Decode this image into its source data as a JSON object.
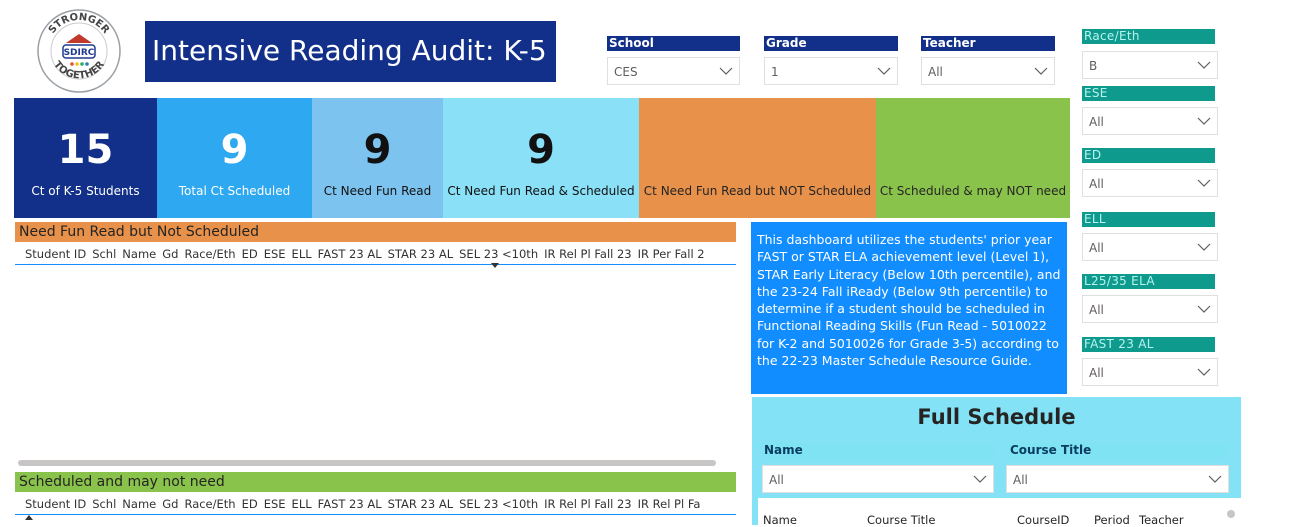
{
  "logo": {
    "top_text": "STRONGER",
    "middle_text": "SDIRC",
    "bottom_text": "TOGETHER"
  },
  "title": "Intensive Reading Audit: K-5",
  "slicers": {
    "school": {
      "label": "School",
      "value": "CES"
    },
    "grade": {
      "label": "Grade",
      "value": "1"
    },
    "teacher": {
      "label": "Teacher",
      "value": "All"
    },
    "race_eth": {
      "label": "Race/Eth",
      "value": "B"
    },
    "ese": {
      "label": "ESE",
      "value": "All"
    },
    "ed": {
      "label": "ED",
      "value": "All"
    },
    "ell": {
      "label": "ELL",
      "value": "All"
    },
    "l25": {
      "label": "L25/35 ELA",
      "value": "All"
    },
    "fast23": {
      "label": "FAST 23 AL",
      "value": "All"
    }
  },
  "cards": [
    {
      "value": "15",
      "label": "Ct of K-5 Students",
      "bg": "#12308a",
      "fg": "#ffffff"
    },
    {
      "value": "9",
      "label": "Total Ct Scheduled",
      "bg": "#2ea8f0",
      "fg": "#ffffff"
    },
    {
      "value": "9",
      "label": "Ct Need Fun Read",
      "bg": "#7cc3f0",
      "fg": "#111111"
    },
    {
      "value": "9",
      "label": "Ct Need Fun Read & Scheduled",
      "bg": "#8ae0f7",
      "fg": "#111111"
    },
    {
      "value": "",
      "label": "Ct Need Fun Read but NOT Scheduled",
      "bg": "#e8914a",
      "fg": "#252423"
    },
    {
      "value": "",
      "label": "Ct Scheduled & may NOT need",
      "bg": "#8ac34c",
      "fg": "#252423"
    }
  ],
  "table1": {
    "title": "Need Fun Read but Not Scheduled",
    "columns": [
      "Student ID",
      "Schl",
      "Name",
      "Gd",
      "Race/Eth",
      "ED",
      "ESE",
      "ELL",
      "FAST 23 AL",
      "STAR 23 AL",
      "SEL 23 <10th",
      "IR Rel Pl Fall 23",
      "IR Per Fall 2"
    ]
  },
  "table2": {
    "title": "Scheduled and may not need",
    "columns": [
      "Student ID",
      "Schl",
      "Name",
      "Gd",
      "Race/Eth",
      "ED",
      "ESE",
      "ELL",
      "FAST 23 AL",
      "STAR 23 AL",
      "SEL 23 <10th",
      "IR Rel Pl Fall 23",
      "IR Rel Pl Fa"
    ]
  },
  "info_text": "This dashboard utilizes the students' prior year FAST or STAR ELA achievement level (Level 1), STAR Early Literacy (Below 10th percentile), and the 23-24 Fall iReady (Below 9th percentile) to determine if a student should be scheduled in Functional Reading Skills (Fun Read - 5010022 for K-2 and 5010026 for Grade 3-5) according to the 22-23 Master Schedule Resource Guide.",
  "full_schedule": {
    "title": "Full Schedule",
    "name_label": "Name",
    "name_value": "All",
    "course_label": "Course Title",
    "course_value": "All",
    "columns": [
      "Name",
      "Course Title",
      "CourseID",
      "Period",
      "Teacher"
    ]
  }
}
